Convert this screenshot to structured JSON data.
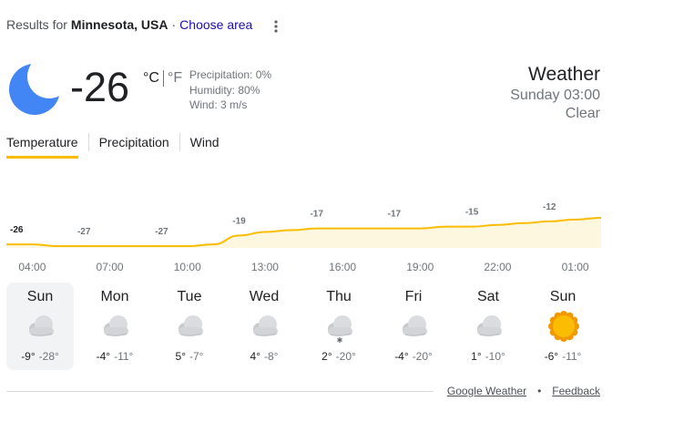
{
  "header": {
    "results_prefix": "Results for",
    "location": "Minnesota, USA",
    "separator": "·",
    "choose_area": "Choose area"
  },
  "current": {
    "icon": "moon-icon",
    "temperature": "-26",
    "unit_c": "°C",
    "unit_f": "°F",
    "precipitation": "Precipitation: 0%",
    "humidity": "Humidity: 80%",
    "wind": "Wind: 3 m/s"
  },
  "summary": {
    "title": "Weather",
    "day_time": "Sunday 03:00",
    "condition": "Clear"
  },
  "tabs": [
    {
      "label": "Temperature",
      "active": true
    },
    {
      "label": "Precipitation",
      "active": false
    },
    {
      "label": "Wind",
      "active": false
    }
  ],
  "chart_data": {
    "type": "area",
    "x": [
      "03:00",
      "04:00",
      "05:00",
      "06:00",
      "07:00",
      "08:00",
      "09:00",
      "10:00",
      "11:00",
      "12:00",
      "13:00",
      "14:00",
      "15:00",
      "16:00",
      "17:00",
      "18:00",
      "19:00",
      "20:00",
      "21:00",
      "22:00",
      "23:00",
      "00:00",
      "01:00",
      "02:00"
    ],
    "values": [
      -26,
      -26,
      -27,
      -27,
      -27,
      -27,
      -27,
      -27,
      -26,
      -21,
      -19,
      -18,
      -17,
      -17,
      -17,
      -17,
      -17,
      -16,
      -16,
      -15,
      -14,
      -13,
      -12,
      -11
    ],
    "labels": [
      "-26",
      "-27",
      "-27",
      "-19",
      "-17",
      "-17",
      "-15",
      "-12"
    ],
    "label_indices": [
      0,
      3,
      6,
      9,
      12,
      15,
      18,
      21
    ],
    "line_color": "#fbbc04",
    "fill_color": "#fef7e0",
    "tick_labels": [
      "04:00",
      "07:00",
      "10:00",
      "13:00",
      "16:00",
      "19:00",
      "22:00",
      "01:00"
    ]
  },
  "forecast": [
    {
      "day": "Sun",
      "icon": "cloud-icon",
      "hi": "-9°",
      "lo": "-28°",
      "selected": true
    },
    {
      "day": "Mon",
      "icon": "cloud-icon",
      "hi": "-4°",
      "lo": "-11°",
      "selected": false
    },
    {
      "day": "Tue",
      "icon": "cloud-icon",
      "hi": "5°",
      "lo": "-7°",
      "selected": false
    },
    {
      "day": "Wed",
      "icon": "cloud-icon",
      "hi": "4°",
      "lo": "-8°",
      "selected": false
    },
    {
      "day": "Thu",
      "icon": "snow-cloud-icon",
      "hi": "2°",
      "lo": "-20°",
      "selected": false
    },
    {
      "day": "Fri",
      "icon": "cloud-icon",
      "hi": "-4°",
      "lo": "-20°",
      "selected": false
    },
    {
      "day": "Sat",
      "icon": "cloud-icon",
      "hi": "1°",
      "lo": "-10°",
      "selected": false
    },
    {
      "day": "Sun",
      "icon": "sun-icon",
      "hi": "-6°",
      "lo": "-11°",
      "selected": false
    }
  ],
  "footer": {
    "source": "Google Weather",
    "dot": "•",
    "feedback": "Feedback"
  },
  "colors": {
    "accent": "#fbbc04",
    "link": "#1a0dab",
    "moon": "#4285f4"
  }
}
